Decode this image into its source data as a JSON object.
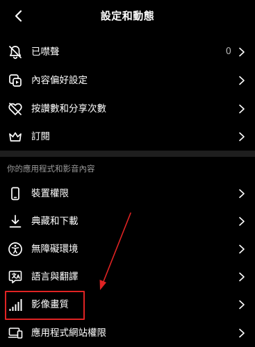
{
  "header": {
    "title": "設定和動態"
  },
  "settings_items": [
    {
      "label": "已噤聲",
      "value": "0",
      "icon": "bell-off-icon"
    },
    {
      "label": "內容偏好設定",
      "value": "",
      "icon": "content-preferences-icon"
    },
    {
      "label": "按讚數和分享次數",
      "value": "",
      "icon": "heart-off-icon"
    },
    {
      "label": "訂閱",
      "value": "",
      "icon": "crown-icon"
    }
  ],
  "apps_section": {
    "title": "你的應用程式和影音內容",
    "items": [
      {
        "label": "裝置權限",
        "icon": "phone-icon"
      },
      {
        "label": "典藏和下載",
        "icon": "download-icon"
      },
      {
        "label": "無障礙環境",
        "icon": "accessibility-icon"
      },
      {
        "label": "語言與翻譯",
        "icon": "translate-icon"
      },
      {
        "label": "影像畫質",
        "icon": "signal-bars-icon"
      },
      {
        "label": "應用程式網站權限",
        "icon": "devices-icon"
      }
    ]
  },
  "colors": {
    "background": "#000000",
    "text": "#ffffff",
    "secondary_text": "#9a9a9a",
    "separator": "#1e1e1e",
    "annotation": "#e02323"
  }
}
